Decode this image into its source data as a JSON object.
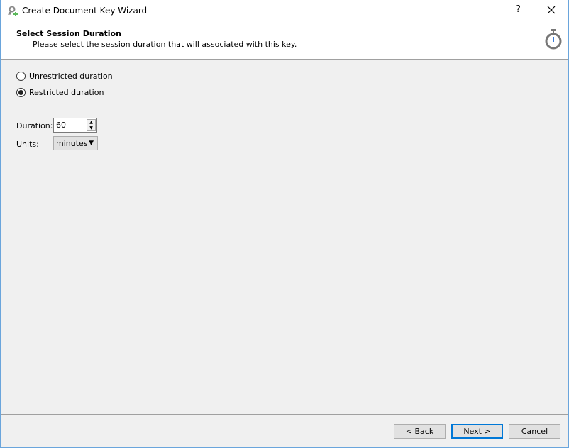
{
  "window": {
    "title": "Create Document Key Wizard",
    "help": "?",
    "accent": "#0078d7"
  },
  "header": {
    "title": "Select Session Duration",
    "subtitle": "Please select the session duration that will associated with this key."
  },
  "options": [
    {
      "label": "Unrestricted duration",
      "selected": false
    },
    {
      "label": "Restricted duration",
      "selected": true
    }
  ],
  "duration": {
    "label": "Duration:",
    "value": "60"
  },
  "units": {
    "label": "Units:",
    "value": "minutes"
  },
  "buttons": {
    "back": "< Back",
    "next": "Next >",
    "cancel": "Cancel"
  }
}
